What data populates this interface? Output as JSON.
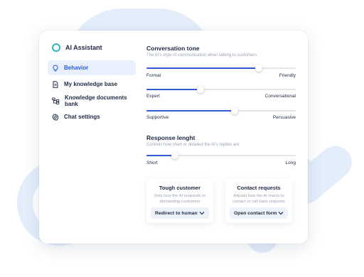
{
  "app": {
    "name": "AI Assistant"
  },
  "sidebar": {
    "items": [
      {
        "label": "Behavior",
        "icon": "bulb-icon",
        "active": true
      },
      {
        "label": "My knowledge base",
        "icon": "document-icon",
        "active": false
      },
      {
        "label": "Knowledge documents bank",
        "icon": "folders-icon",
        "active": false
      },
      {
        "label": "Chat settings",
        "icon": "gear-icon",
        "active": false
      }
    ]
  },
  "tone": {
    "title": "Conversation tone",
    "subtitle": "The AI's style of communication when talking to customers",
    "sliders": [
      {
        "left": "Formal",
        "right": "Friendly",
        "value": 0.75
      },
      {
        "left": "Expert",
        "right": "Conversational",
        "value": 0.36
      },
      {
        "left": "Supportive",
        "right": "Persuasive",
        "value": 0.59
      }
    ]
  },
  "length": {
    "title": "Response lenght",
    "subtitle": "Controls how short or detailed the AI's replies are",
    "slider": {
      "left": "Short",
      "right": "Long",
      "value": 0.19
    }
  },
  "cards": [
    {
      "title": "Tough customer",
      "description": "Sets how the AI responds to demanding customers",
      "dropdown": "Redirect to human"
    },
    {
      "title": "Contact requests",
      "description": "Adjusts how the AI reacts to contact or call-back requests",
      "dropdown": "Open contact form"
    }
  ],
  "colors": {
    "accent": "#2f5bd4",
    "brand": "#2db6c9",
    "active_bg": "#e7f0fc"
  }
}
